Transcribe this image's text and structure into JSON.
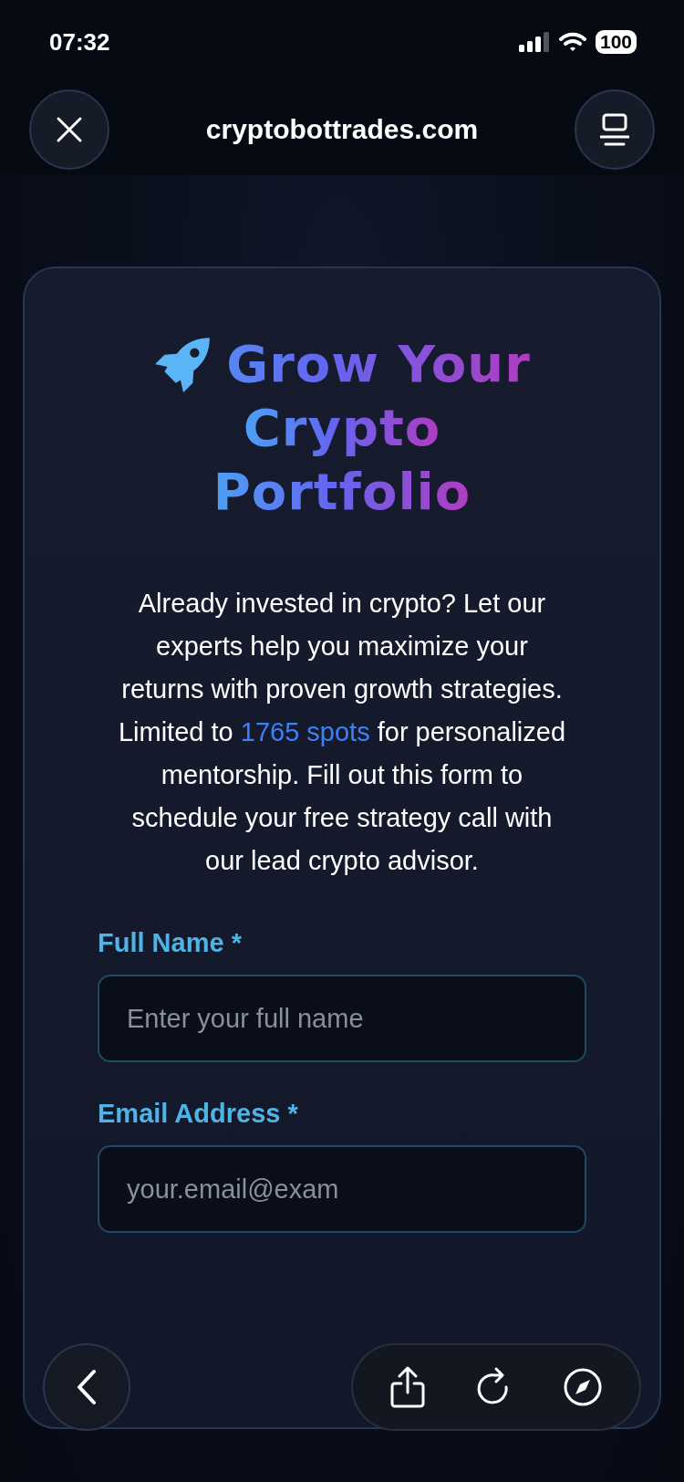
{
  "status_bar": {
    "time": "07:32",
    "battery": "100"
  },
  "browser_header": {
    "title": "cryptobottrades.com"
  },
  "card": {
    "title_lines": [
      "Grow Your",
      "Crypto",
      "Portfolio"
    ],
    "intro": "Already invested in crypto? Let our experts help you maximize your returns with proven growth strategies.",
    "offer": {
      "before": "Limited to ",
      "highlight": "1765 spots",
      "after": " for personalized mentorship. Fill out this form to schedule your free strategy call with our lead crypto advisor."
    },
    "fields": [
      {
        "label": "Full Name *",
        "placeholder": "Enter your full name"
      },
      {
        "label": "Email Address *",
        "placeholder": "your.email@exam"
      }
    ]
  }
}
